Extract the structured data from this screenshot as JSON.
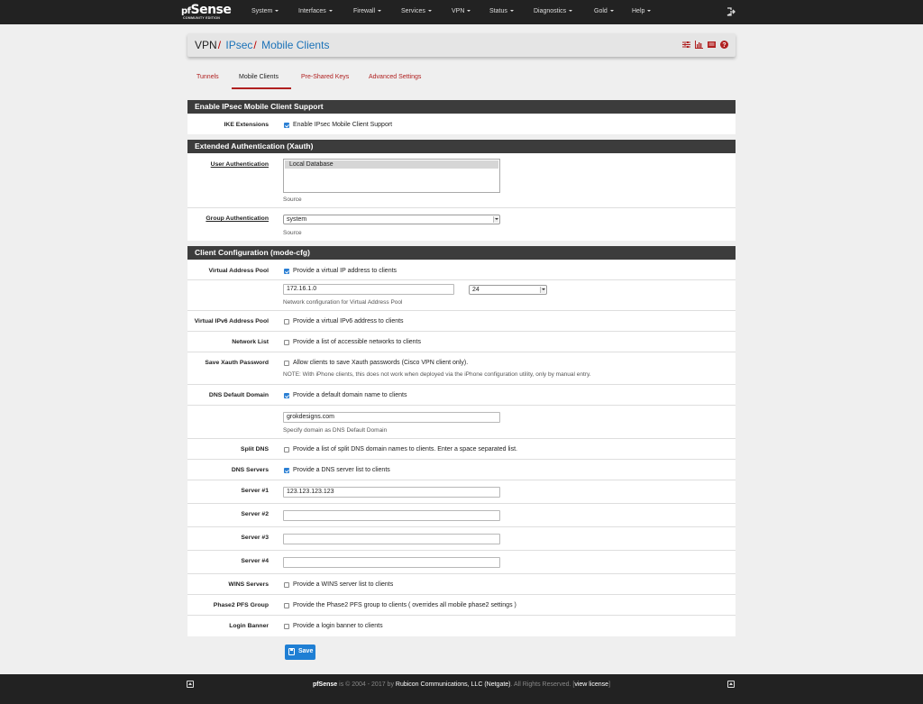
{
  "app": {
    "logo_word": "Sense",
    "logo_prefix": "pf",
    "logo_sub": "COMMUNITY EDITION"
  },
  "nav": {
    "items": [
      "System",
      "Interfaces",
      "Firewall",
      "Services",
      "VPN",
      "Status",
      "Diagnostics",
      "Gold",
      "Help"
    ]
  },
  "breadcrumb": {
    "root": "VPN",
    "separator": "/",
    "level1": "IPsec",
    "level2": "Mobile Clients"
  },
  "tabs": [
    "Tunnels",
    "Mobile Clients",
    "Pre-Shared Keys",
    "Advanced Settings"
  ],
  "active_tab": "Mobile Clients",
  "sections": {
    "enable": {
      "title": "Enable IPsec Mobile Client Support",
      "ike_label": "IKE Extensions",
      "ike_text": "Enable IPsec Mobile Client Support",
      "ike_checked": true
    },
    "xauth": {
      "title": "Extended Authentication (Xauth)",
      "user_auth_label": "User Authentication",
      "user_auth_option": "Local Database",
      "user_auth_help": "Source",
      "group_auth_label": "Group Authentication",
      "group_auth_value": "system",
      "group_auth_help": "Source"
    },
    "client": {
      "title": "Client Configuration (mode-cfg)",
      "vap_label": "Virtual Address Pool",
      "vap_text": "Provide a virtual IP address to clients",
      "vap_checked": true,
      "vap_network": "172.16.1.0",
      "vap_mask": "24",
      "vap_help": "Network configuration for Virtual Address Pool",
      "v6_label": "Virtual IPv6 Address Pool",
      "v6_text": "Provide a virtual IPv6 address to clients",
      "v6_checked": false,
      "netlist_label": "Network List",
      "netlist_text": "Provide a list of accessible networks to clients",
      "netlist_checked": false,
      "savex_label": "Save Xauth Password",
      "savex_text": "Allow clients to save Xauth passwords (Cisco VPN client only).",
      "savex_note": "NOTE: With iPhone clients, this does not work when deployed via the iPhone configuration utility, only by manual entry.",
      "savex_checked": false,
      "dnsdom_label": "DNS Default Domain",
      "dnsdom_text": "Provide a default domain name to clients",
      "dnsdom_checked": true,
      "dnsdom_value": "grokdesigns.com",
      "dnsdom_help": "Specify domain as DNS Default Domain",
      "split_label": "Split DNS",
      "split_text": "Provide a list of split DNS domain names to clients. Enter a space separated list.",
      "split_checked": false,
      "dnssrv_label": "DNS Servers",
      "dnssrv_text": "Provide a DNS server list to clients",
      "dnssrv_checked": true,
      "server1_label": "Server #1",
      "server1_value": "123.123.123.123",
      "server2_label": "Server #2",
      "server2_value": "",
      "server3_label": "Server #3",
      "server3_value": "",
      "server4_label": "Server #4",
      "server4_value": "",
      "wins_label": "WINS Servers",
      "wins_text": "Provide a WINS server list to clients",
      "wins_checked": false,
      "pfs_label": "Phase2 PFS Group",
      "pfs_text": "Provide the Phase2 PFS group to clients ( overrides all mobile phase2 settings )",
      "pfs_checked": false,
      "banner_label": "Login Banner",
      "banner_text": "Provide a login banner to clients",
      "banner_checked": false
    }
  },
  "save_label": "Save",
  "footer": {
    "product": "pfSense",
    "copyright": " is © 2004 - 2017 by ",
    "company": "Rubicon Communications, LLC (Netgate)",
    "rights": ". All Rights Reserved. [",
    "license": "view license",
    "close": "]"
  },
  "colors": {
    "navbar": "#222222",
    "section_header": "#3c3c3c",
    "link_blue": "#1b72b8",
    "tab_red": "#b02020",
    "checkbox_blue": "#2a7fd4"
  },
  "icons": [
    "logout-icon",
    "sliders-icon",
    "bar-chart-icon",
    "list-icon",
    "help-icon",
    "floppy-disk-icon",
    "scroll-top-icon"
  ]
}
